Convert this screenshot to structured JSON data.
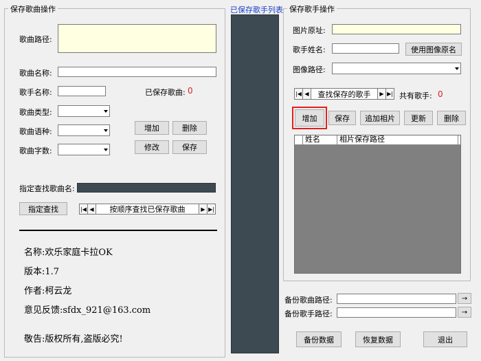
{
  "song_group": {
    "title": "保存歌曲操作",
    "path_label": "歌曲路径:",
    "name_label": "歌曲名称:",
    "singer_label": "歌手名称:",
    "saved_label": "已保存歌曲:",
    "saved_count": "0",
    "type_label": "歌曲类型:",
    "lang_label": "歌曲语种:",
    "chars_label": "歌曲字数:",
    "add_button": "增加",
    "delete_button": "删除",
    "modify_button": "修改",
    "save_button": "保存",
    "find_label": "指定查找歌曲名:",
    "find_button": "指定查找",
    "nav_text": "按顺序查找已保存歌曲"
  },
  "about": {
    "name": "名称:欢乐家庭卡拉OK",
    "version": "版本:1.7",
    "author": "作者:柯云龙",
    "feedback": "意见反馈:sfdx_921@163.com",
    "warning": "敬告:版权所有,盗版必究!"
  },
  "middle_list": {
    "title": "已保存歌手列表"
  },
  "singer_group": {
    "title": "保存歌手操作",
    "image_source_label": "图片原址:",
    "singer_name_label": "歌手姓名:",
    "use_image_name_button": "使用图像原名",
    "image_path_label": "图像路径:",
    "nav_text": "查找保存的歌手",
    "total_label": "共有歌手:",
    "total_count": "0",
    "add_button": "增加",
    "save_button": "保存",
    "add_photo_button": "追加相片",
    "update_button": "更新",
    "delete_button": "删除",
    "grid_headers": [
      "姓名",
      "相片保存路径"
    ]
  },
  "backup": {
    "song_path_label": "备份歌曲路径:",
    "singer_path_label": "备份歌手路径:",
    "backup_button": "备份数据",
    "restore_button": "恢复数据",
    "exit_button": "退出"
  }
}
